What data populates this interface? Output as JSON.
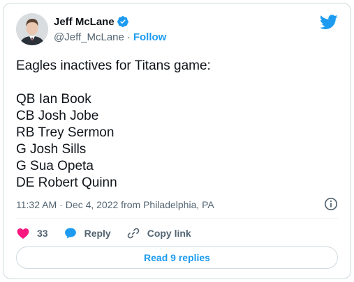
{
  "author": {
    "display_name": "Jeff McLane",
    "handle": "@Jeff_McLane",
    "separator": "·",
    "follow_label": "Follow",
    "verified": true
  },
  "tweet": {
    "text": "Eagles inactives for Titans game:\n\nQB Ian Book\nCB Josh Jobe\nRB Trey Sermon\nG Josh Sills\nG Sua Opeta\nDE Robert Quinn",
    "time": "11:32 AM",
    "date_separator": "·",
    "date": "Dec 4, 2022 from Philadelphia, PA"
  },
  "actions": {
    "like_count": "33",
    "reply_label": "Reply",
    "copy_link_label": "Copy link"
  },
  "replies_button": "Read 9 replies",
  "colors": {
    "accent": "#1d9bf0",
    "like": "#f91880",
    "text": "#0f1419",
    "muted": "#536471"
  },
  "icons": [
    "twitter-bird-icon",
    "verified-badge-icon",
    "info-icon",
    "heart-icon",
    "reply-bubble-icon",
    "link-icon"
  ]
}
